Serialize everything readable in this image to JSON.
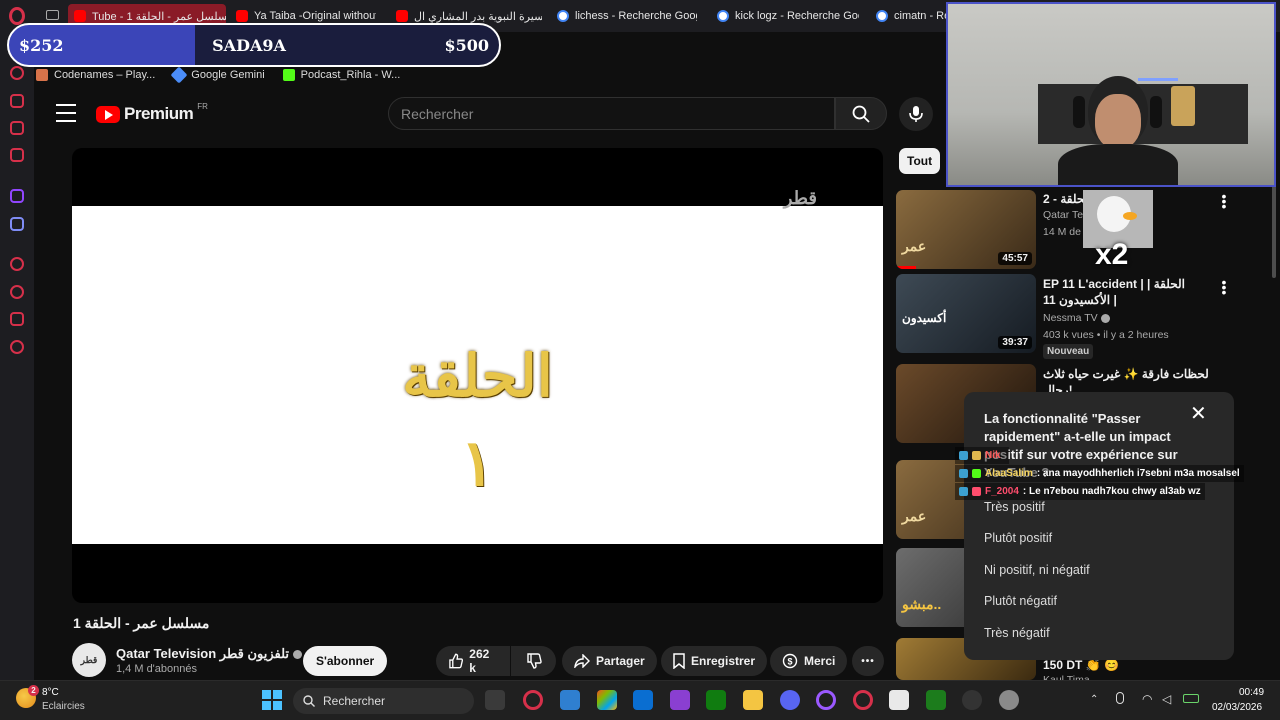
{
  "browser": {
    "tabs": [
      {
        "label": "Tube - مسلسل عمر - الحلقة 1",
        "active": true,
        "favicon": "youtube-icon"
      },
      {
        "label": "Ya Taiba -Original without",
        "favicon": "youtube-icon"
      },
      {
        "label": "السيرة النبوية بدر المشاري ال",
        "favicon": "youtube-icon"
      },
      {
        "label": "lichess - Recherche Goog",
        "favicon": "google-icon"
      },
      {
        "label": "kick logz - Recherche Goo",
        "favicon": "google-icon"
      },
      {
        "label": "cimatn - Re",
        "favicon": "google-icon"
      }
    ],
    "bookmarks": [
      {
        "label": "Codenames – Play...",
        "color": "#d8734a"
      },
      {
        "label": "Google Gemini",
        "color": "#4b8df8"
      },
      {
        "label": "Podcast_Rihla - W...",
        "color": "#53fc18"
      }
    ]
  },
  "overlay": {
    "left_amount": "$252",
    "name": "SADA9A",
    "right_amount": "$500"
  },
  "youtube": {
    "logo_text": "Premium",
    "logo_region": "FR",
    "search_placeholder": "Rechercher",
    "video": {
      "channel_watermark": "قطر",
      "title_card": "الحلقة",
      "title_number": "١",
      "title": "مسلسل عمر - الحلقة 1",
      "channel": "Qatar Television تلفزيون قطر",
      "channel_avatar_text": "قطر",
      "subscribers": "1,4 M d'abonnés",
      "subscribe_label": "S'abonner",
      "likes": "262 k",
      "share_label": "Partager",
      "save_label": "Enregistrer",
      "thanks_label": "Merci",
      "more_label": "•••"
    },
    "chip": "Tout",
    "recommendations": [
      {
        "title": "2 - الحلقة",
        "channel": "Qatar Te...",
        "meta": "14 M de ...",
        "duration": "45:57",
        "thumb_text": "عمر",
        "thumb_color": "#6b5434"
      },
      {
        "title": "EP 11 L'accident | الحلقة | الأكسيدون 11 |",
        "channel": "Nessma TV",
        "meta": "403 k vues • il y a 2 heures",
        "badge": "Nouveau",
        "duration": "39:37",
        "thumb_text": "أكسيدون",
        "thumb_color": "#2f3a44"
      },
      {
        "title": "لحظات فارقة ✨ غيرت حياه ثلاث رجال!",
        "channel": "",
        "meta": "",
        "duration": "",
        "thumb_text": "",
        "thumb_color": "#5a4026"
      },
      {
        "title": "",
        "channel": "",
        "meta": "",
        "duration": "",
        "thumb_text": "عمر",
        "thumb_color": "#6b5434"
      },
      {
        "title": "",
        "channel": "",
        "meta": "",
        "duration": "",
        "thumb_text": "مبشو..",
        "thumb_color": "#4a4a4a"
      },
      {
        "title": "150 DT 👏 😊",
        "channel": "Kaul Tima",
        "meta": "",
        "duration": "",
        "thumb_text": "",
        "thumb_color": "#8a6a2c"
      }
    ],
    "survey": {
      "question": "La fonctionnalité \"Passer rapidement\" a-t-elle un impact positif sur votre expérience sur YouTube ?",
      "close_label": "✕",
      "options": [
        "Très positif",
        "Plutôt positif",
        "Ni positif, ni négatif",
        "Plutôt négatif",
        "Très négatif"
      ]
    }
  },
  "stream": {
    "emote_text": "x2",
    "chat": [
      {
        "user": "Nik",
        "message": "",
        "color": "#ff5a5a"
      },
      {
        "user": "AlaaSalim",
        "message": ": ana mayodhherlich i7sebni m3a mosalsel",
        "color": "#f4d35e"
      },
      {
        "user": "F_2004",
        "message": ": Le n7ebou nadh7kou chwy al3ab wz",
        "color": "#ff4d6d"
      }
    ]
  },
  "taskbar": {
    "weather_badge": "2",
    "temperature": "8°C",
    "weather": "Eclaircies",
    "search_placeholder": "Rechercher",
    "time": "00:49",
    "date": "02/03/2026"
  }
}
